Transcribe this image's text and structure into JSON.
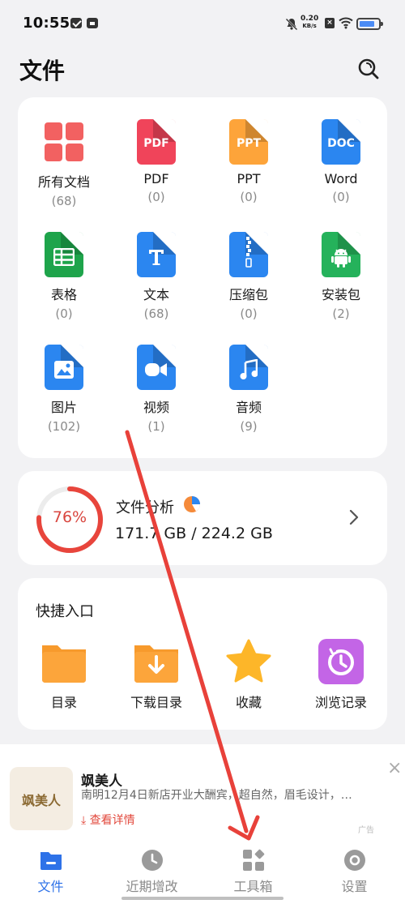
{
  "status_bar": {
    "time": "10:55",
    "net_speed_value": "0.20",
    "net_speed_unit": "KB/s",
    "battery_color": "#4c8cf5"
  },
  "header": {
    "title": "文件",
    "search_icon": "search-icon"
  },
  "categories": [
    {
      "name": "所有文档",
      "count": "(68)",
      "icon": "all-docs-icon",
      "color": "#f26161"
    },
    {
      "name": "PDF",
      "count": "(0)",
      "icon": "pdf-file-icon",
      "color": "#f0445a",
      "badge": "PDF"
    },
    {
      "name": "PPT",
      "count": "(0)",
      "icon": "ppt-file-icon",
      "color": "#fda43a",
      "badge": "PPT"
    },
    {
      "name": "Word",
      "count": "(0)",
      "icon": "word-file-icon",
      "color": "#2b86f0",
      "badge": "DOC"
    },
    {
      "name": "表格",
      "count": "(0)",
      "icon": "spreadsheet-file-icon",
      "color": "#1ea44b"
    },
    {
      "name": "文本",
      "count": "(68)",
      "icon": "text-file-icon",
      "color": "#2b86f0"
    },
    {
      "name": "压缩包",
      "count": "(0)",
      "icon": "archive-file-icon",
      "color": "#2b86f0"
    },
    {
      "name": "安装包",
      "count": "(2)",
      "icon": "apk-file-icon",
      "color": "#25b25b"
    },
    {
      "name": "图片",
      "count": "(102)",
      "icon": "image-file-icon",
      "color": "#2b86f0"
    },
    {
      "name": "视频",
      "count": "(1)",
      "icon": "video-file-icon",
      "color": "#2b86f0"
    },
    {
      "name": "音频",
      "count": "(9)",
      "icon": "audio-file-icon",
      "color": "#2b86f0"
    }
  ],
  "storage": {
    "percent_label": "76%",
    "used_fraction": 0.76,
    "title": "文件分析",
    "size": "171.7 GB / 224.2 GB",
    "ring_color": "#e8453c"
  },
  "quick_access": {
    "title": "快捷入口",
    "items": [
      {
        "label": "目录",
        "icon": "folder-icon",
        "color": "#fca53b"
      },
      {
        "label": "下载目录",
        "icon": "download-folder-icon",
        "color": "#fca53b"
      },
      {
        "label": "收藏",
        "icon": "star-icon",
        "color": "#fdb629"
      },
      {
        "label": "浏览记录",
        "icon": "history-icon",
        "color": "#c365e6"
      }
    ]
  },
  "ad": {
    "logo_text": "飒美人",
    "title": "飒美人",
    "description": "南明12月4日新店开业大酬宾，超自然，眉毛设计，…",
    "link": "查看详情",
    "tag": "广告"
  },
  "bottom_nav": [
    {
      "label": "文件",
      "icon": "folder-home-icon",
      "active": true
    },
    {
      "label": "近期增改",
      "icon": "clock-icon",
      "active": false
    },
    {
      "label": "工具箱",
      "icon": "toolbox-icon",
      "active": false
    },
    {
      "label": "设置",
      "icon": "settings-icon",
      "active": false
    }
  ],
  "accent_color": "#2e72e8"
}
